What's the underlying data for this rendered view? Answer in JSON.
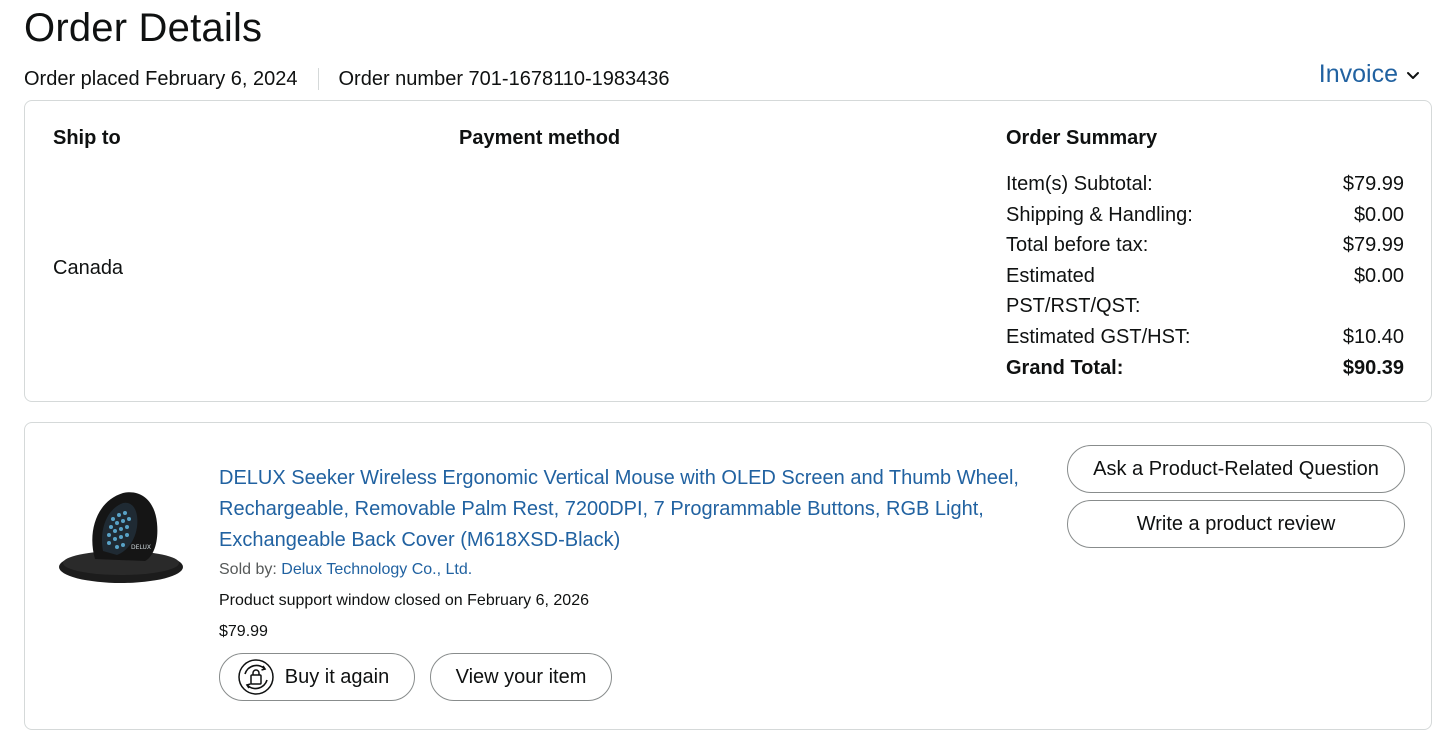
{
  "page": {
    "title": "Order Details"
  },
  "order_meta": {
    "placed": "Order placed February 6, 2024",
    "number": "Order number 701-1678110-1983436",
    "invoice_label": "Invoice"
  },
  "shipping": {
    "heading": "Ship to",
    "country": "Canada"
  },
  "payment": {
    "heading": "Payment method"
  },
  "summary": {
    "heading": "Order Summary",
    "rows": [
      {
        "label": "Item(s) Subtotal:",
        "value": "$79.99"
      },
      {
        "label": "Shipping & Handling:",
        "value": "$0.00"
      },
      {
        "label": "Total before tax:",
        "value": "$79.99"
      },
      {
        "label": "Estimated PST/RST/QST:",
        "value": "$0.00"
      },
      {
        "label": "Estimated GST/HST:",
        "value": "$10.40"
      },
      {
        "label": "Grand Total:",
        "value": "$90.39"
      }
    ]
  },
  "item": {
    "title": "DELUX Seeker Wireless Ergonomic Vertical Mouse with OLED Screen and Thumb Wheel, Rechargeable, Removable Palm Rest, 7200DPI, 7 Programmable Buttons, RGB Light, Exchangeable Back Cover (M618XSD-Black)",
    "sold_by_label": "Sold by:",
    "seller": "Delux Technology Co., Ltd.",
    "support_text": "Product support window closed on February 6, 2026",
    "price": "$79.99",
    "image_brand_text": "DELUX",
    "buttons": {
      "buy_again": "Buy it again",
      "view_item": "View your item",
      "ask_question": "Ask a Product-Related Question",
      "write_review": "Write a product review"
    }
  },
  "colors": {
    "link": "#2162a1",
    "text": "#0f1111",
    "border": "#d5d9d9"
  },
  "icons": {
    "invoice_chevron": "chevron-down-icon",
    "buy_again": "buy-again-icon"
  }
}
